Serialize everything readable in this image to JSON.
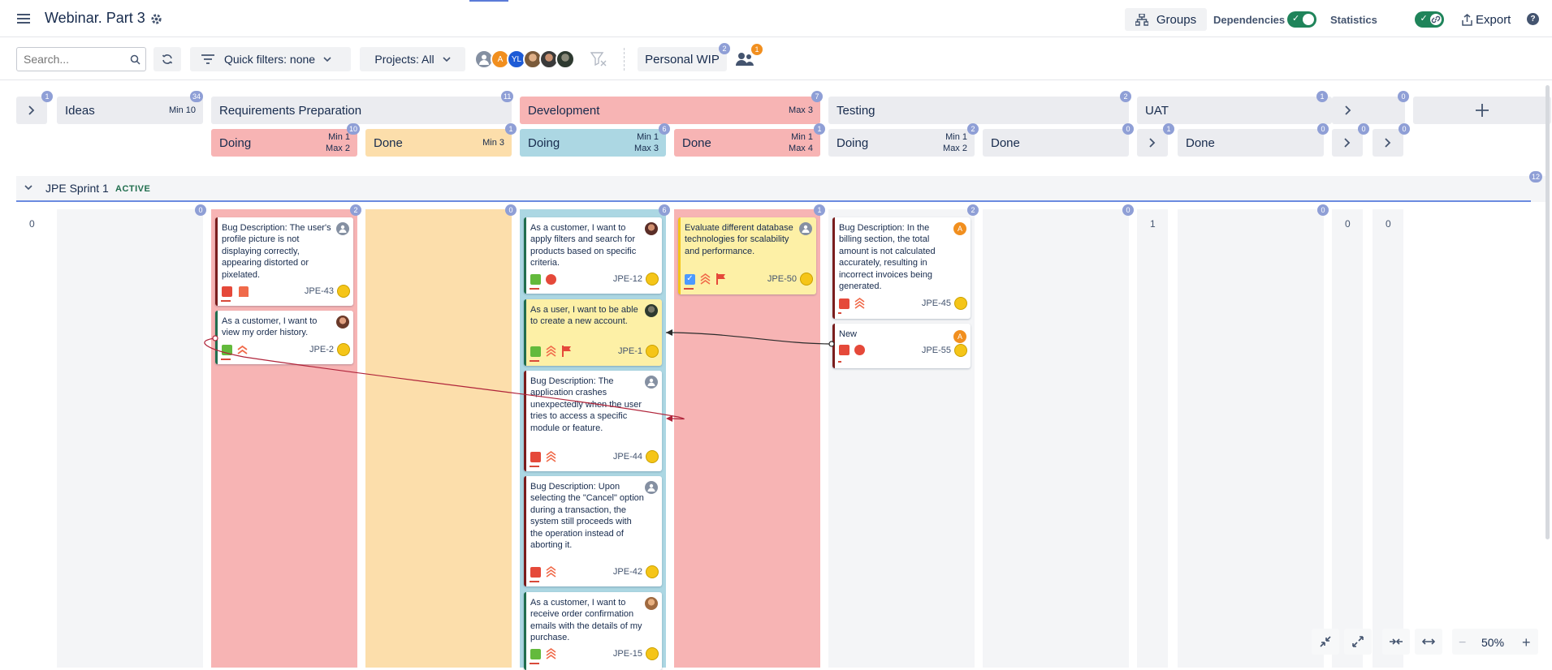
{
  "header": {
    "title": "Webinar. Part 3",
    "groups": "Groups",
    "dependencies": "Dependencies",
    "statistics": "Statistics",
    "export": "Export"
  },
  "toolbar": {
    "search_placeholder": "Search...",
    "quick_filters": "Quick filters: none",
    "projects": "Projects: All",
    "personal_wip": "Personal WIP",
    "wip_badge": "2",
    "team_badge": "1",
    "avatars": [
      "A",
      "YL"
    ]
  },
  "columns": {
    "ideas": {
      "label": "Ideas",
      "limit": "Min 10",
      "badge": "34",
      "collapsed_badge": "1"
    },
    "req": {
      "label": "Requirements Preparation",
      "badge": "11"
    },
    "req_doing": {
      "label": "Doing",
      "min": "Min 1",
      "max": "Max 2",
      "badge": "10"
    },
    "req_done": {
      "label": "Done",
      "limit": "Min 3",
      "badge": "1"
    },
    "dev": {
      "label": "Development",
      "limit": "Max 3",
      "badge": "7"
    },
    "dev_doing": {
      "label": "Doing",
      "min": "Min 1",
      "max": "Max 3",
      "badge": "6"
    },
    "dev_done": {
      "label": "Done",
      "min": "Min 1",
      "max": "Max 4",
      "badge": "1"
    },
    "testing": {
      "label": "Testing",
      "badge": "2"
    },
    "test_doing": {
      "label": "Doing",
      "min": "Min 1",
      "max": "Max 2",
      "badge": "2"
    },
    "test_done": {
      "label": "Done",
      "badge": "0"
    },
    "uat": {
      "label": "UAT",
      "badge": "1"
    },
    "uat_collapsed_badge": "1",
    "uat_done": {
      "label": "Done",
      "badge": "0"
    },
    "after_uat_badge": "0",
    "ext1_badge": "0",
    "ext2_badge": "0"
  },
  "swimlane": {
    "name": "JPE Sprint 1",
    "status": "ACTIVE",
    "badge": "12"
  },
  "lane_counts": {
    "c0": "0",
    "c1": "0",
    "c2": "2",
    "c3": "0",
    "c4": "6",
    "c5": "1",
    "c6": "2",
    "c7": "0",
    "c8": "1",
    "c9": "0",
    "c10": "0",
    "c11": "0"
  },
  "cards": [
    {
      "text": "Bug Description: The user's profile picture is not displaying correctly, appearing distorted or pixelated.",
      "key": "JPE-43"
    },
    {
      "text": "As a customer, I want to view my order history.",
      "key": "JPE-2"
    },
    {
      "text": "As a customer, I want to apply filters and search for products based on specific criteria.",
      "key": "JPE-12"
    },
    {
      "text": "As a user, I want to be able to create a new account.",
      "key": "JPE-1"
    },
    {
      "text": "Bug Description: The application crashes unexpectedly when the user tries to access a specific module or feature.",
      "key": "JPE-44"
    },
    {
      "text": "Bug Description: Upon selecting the \"Cancel\" option during a transaction, the system still proceeds with the operation instead of aborting it.",
      "key": "JPE-42"
    },
    {
      "text": "As a customer, I want to receive order confirmation emails with the details of my purchase.",
      "key": "JPE-15"
    },
    {
      "text": "Evaluate different database technologies for scalability and performance.",
      "key": "JPE-50"
    },
    {
      "text": "Bug Description: In the billing section, the total amount is not calculated accurately, resulting in incorrect invoices being generated.",
      "key": "JPE-45"
    },
    {
      "text": "New",
      "key": "JPE-55"
    }
  ],
  "card_avatar_initial": "A",
  "zoom": "50%"
}
